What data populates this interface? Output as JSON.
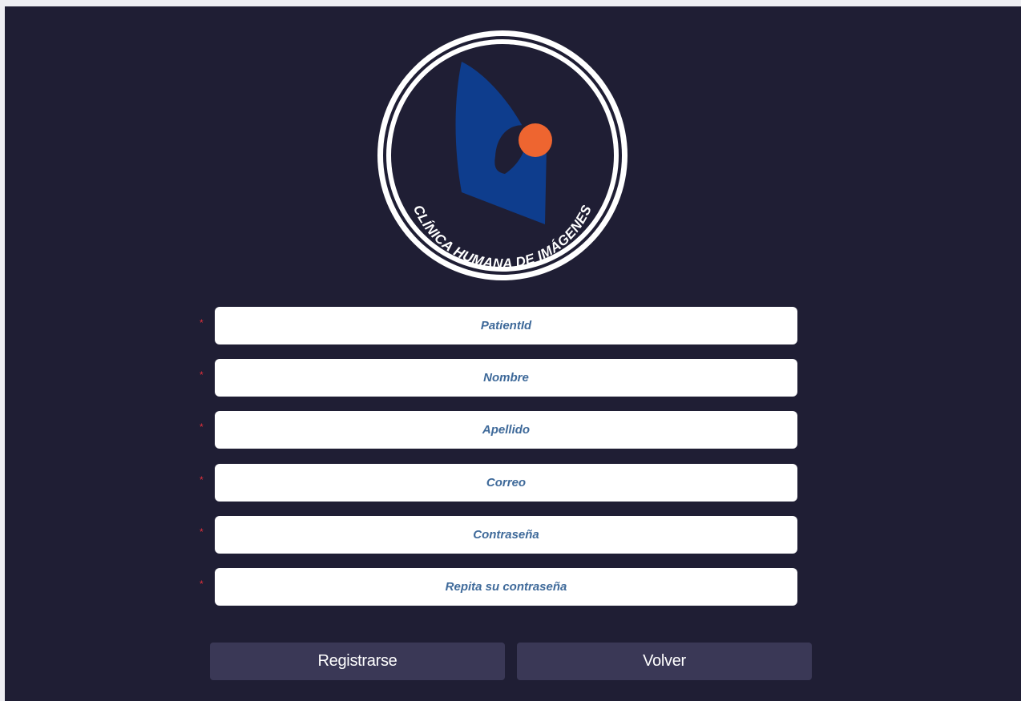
{
  "logo": {
    "text": "CLÍNICA HUMANA DE IMÁGENES",
    "colors": {
      "ring": "#ffffff",
      "shape": "#0e3d8d",
      "dot": "#ee6530"
    }
  },
  "form": {
    "required_mark": "*",
    "fields": [
      {
        "placeholder": "PatientId"
      },
      {
        "placeholder": "Nombre"
      },
      {
        "placeholder": "Apellido"
      },
      {
        "placeholder": "Correo"
      },
      {
        "placeholder": "Contraseña"
      },
      {
        "placeholder": "Repita su contraseña"
      }
    ]
  },
  "actions": {
    "register_label": "Registrarse",
    "back_label": "Volver"
  },
  "colors": {
    "background": "#1f1e34",
    "button": "#3a3856",
    "required": "#e0303a"
  }
}
